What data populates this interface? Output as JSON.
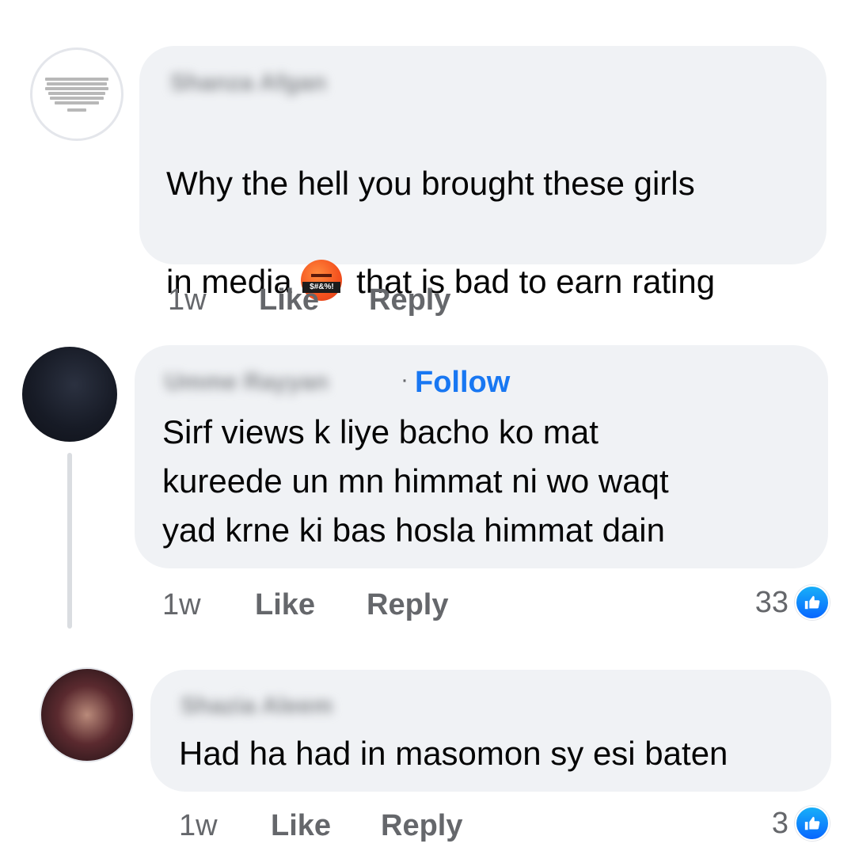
{
  "comments": [
    {
      "author": "Shanza Afgan",
      "text_line1": "Why the hell you brought these girls",
      "text_line2_pre": "in media",
      "text_line2_post": "that is bad to earn rating",
      "emoji_cursing_label": "$#&%!",
      "time": "1w",
      "like_label": "Like",
      "reply_label": "Reply"
    },
    {
      "author": "Umme Rayyan",
      "follow_label": "Follow",
      "text": "Sirf views k liye bacho ko mat\nkureede un mn himmat ni wo waqt\nyad krne ki bas hosla himmat dain",
      "time": "1w",
      "like_label": "Like",
      "reply_label": "Reply",
      "reaction_count": "33"
    },
    {
      "author": "Shazia Aleem",
      "text": "Had ha had in masomon sy esi baten",
      "time": "1w",
      "like_label": "Like",
      "reply_label": "Reply",
      "reaction_count": "3"
    }
  ],
  "icons": {
    "reaction": "like-thumbs-up-icon",
    "emojis": [
      "face-with-symbols-on-mouth",
      "face-with-symbols-on-mouth",
      "angry-face",
      "raised-hand"
    ]
  },
  "colors": {
    "bubble": "#f0f2f5",
    "follow": "#1877f2",
    "secondary_text": "#65676b",
    "like_blue": "#0866ff"
  }
}
